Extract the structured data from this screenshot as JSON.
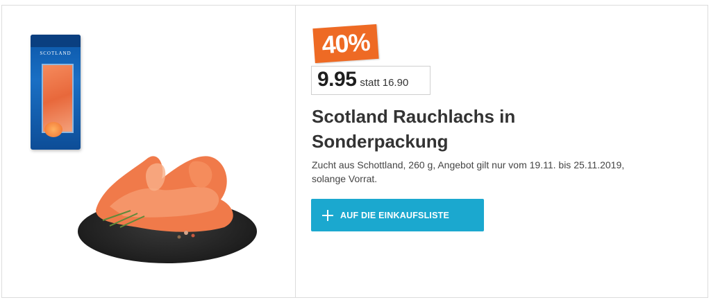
{
  "product": {
    "discount_badge": "40%",
    "price": "9.95",
    "price_prefix": "statt",
    "old_price": "16.90",
    "title_line1": "Scotland Rauchlachs in",
    "title_line2": "Sonderpackung",
    "description_line1": "Zucht aus Schottland, 260 g, Angebot gilt nur vom 19.11. bis 25.11.2019,",
    "description_line2": "solange Vorrat.",
    "package_label": "SCOTLAND"
  },
  "actions": {
    "add_to_list_label": "AUF DIE EINKAUFSLISTE",
    "add_icon": "plus-icon"
  },
  "colors": {
    "badge": "#ee6a24",
    "cta": "#1ba8cf",
    "package": "#0b56a8"
  }
}
